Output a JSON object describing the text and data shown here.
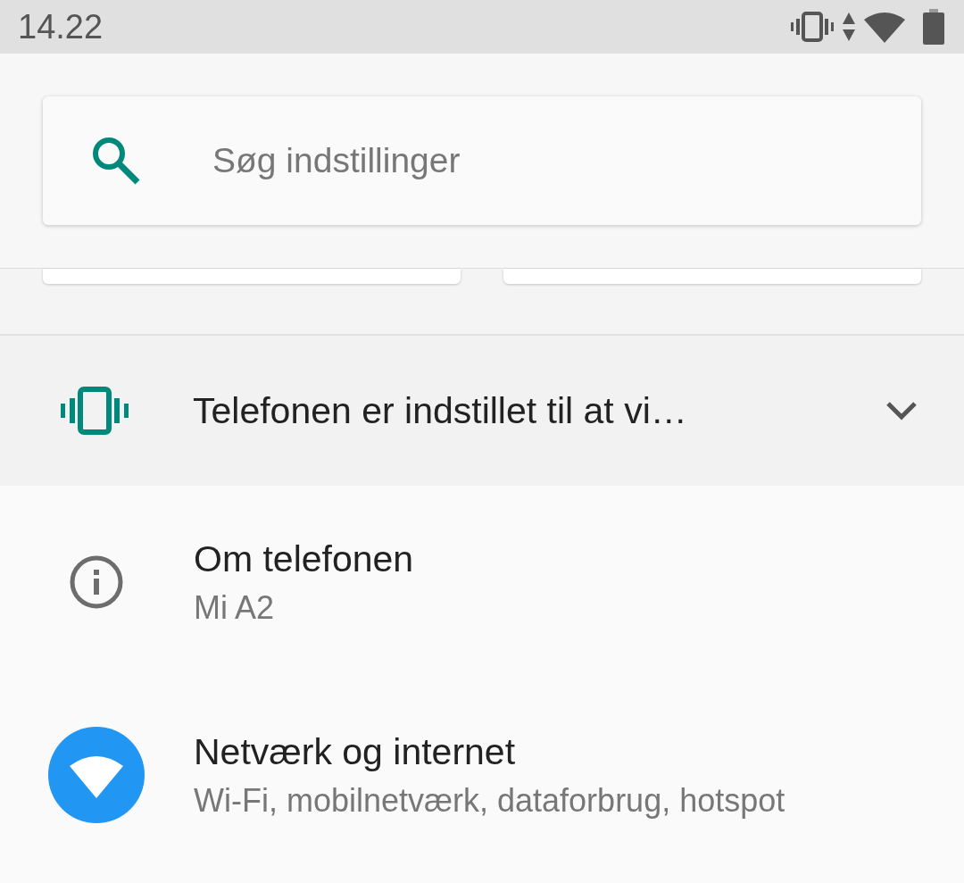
{
  "status_bar": {
    "time": "14.22"
  },
  "search": {
    "placeholder": "Søg indstillinger"
  },
  "condition": {
    "title": "Telefonen er indstillet til at vi…",
    "expanded": false
  },
  "items": [
    {
      "kind": "info",
      "title": "Om telefonen",
      "subtitle": "Mi A2"
    },
    {
      "kind": "wifi",
      "title": "Netværk og internet",
      "subtitle": "Wi-Fi, mobilnetværk, dataforbrug, hotspot"
    }
  ]
}
